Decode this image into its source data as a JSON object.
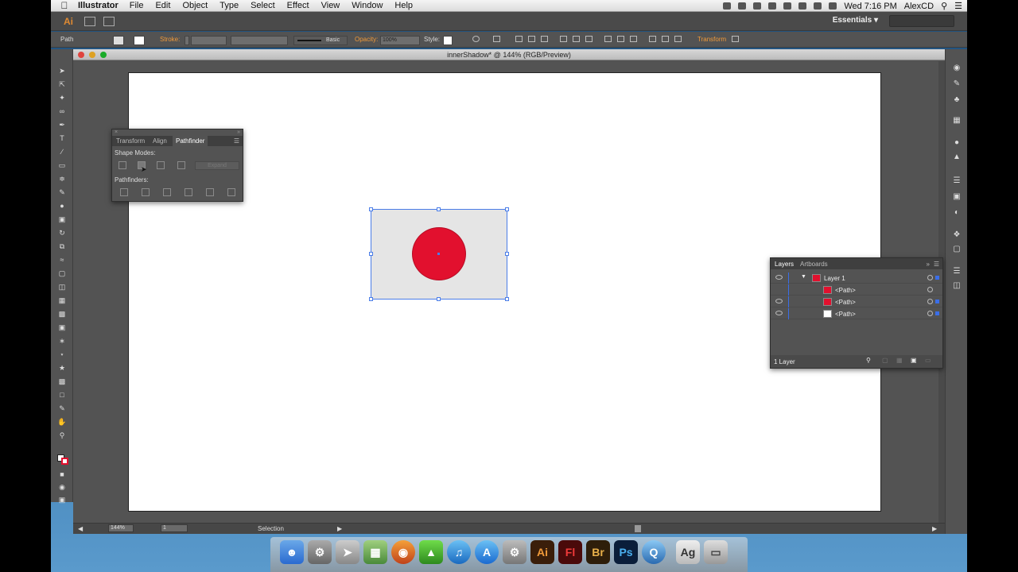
{
  "menubar": {
    "app_name": "Illustrator",
    "items": [
      "File",
      "Edit",
      "Object",
      "Type",
      "Select",
      "Effect",
      "View",
      "Window",
      "Help"
    ],
    "clock": "Wed 7:16 PM",
    "user": "AlexCD"
  },
  "appbar": {
    "logo": "Ai",
    "workspace": "Essentials"
  },
  "control_bar": {
    "selection_type": "Path",
    "stroke_label": "Stroke:",
    "brush_name": "Basic",
    "opacity_label": "Opacity:",
    "opacity_value": "100%",
    "style_label": "Style:",
    "transform_label": "Transform"
  },
  "document": {
    "title": "innerShadow* @ 144% (RGB/Preview)",
    "zoom": "144%",
    "artboard_number": "1",
    "status": "Selection"
  },
  "pathfinder": {
    "tabs": [
      "Transform",
      "Align",
      "Pathfinder"
    ],
    "active_tab": "Pathfinder",
    "shape_modes_label": "Shape Modes:",
    "pathfinders_label": "Pathfinders:",
    "expand_label": "Expand"
  },
  "layers": {
    "tabs": [
      "Layers",
      "Artboards"
    ],
    "rows": [
      {
        "name": "Layer 1",
        "thumb_color": "#e2102e"
      },
      {
        "name": "<Path>",
        "thumb_color": "#e2102e"
      },
      {
        "name": "<Path>",
        "thumb_color": "#e2102e"
      },
      {
        "name": "<Path>",
        "thumb_color": "#ffffff"
      }
    ],
    "footer": "1 Layer"
  },
  "colors": {
    "circle_fill": "#e2102e",
    "rect_fill": "#e5e5e5",
    "selection": "#4a7de8",
    "accent": "#f09a3a"
  },
  "dock_apps": [
    "Finder",
    "System Utilities",
    "Launchpad",
    "Preview",
    "Firefox",
    "Automator",
    "iTunes",
    "App Store",
    "System Preferences",
    "Ai",
    "Fl",
    "Br",
    "Ps",
    "QuickTime",
    "Font Book",
    "Trash"
  ]
}
